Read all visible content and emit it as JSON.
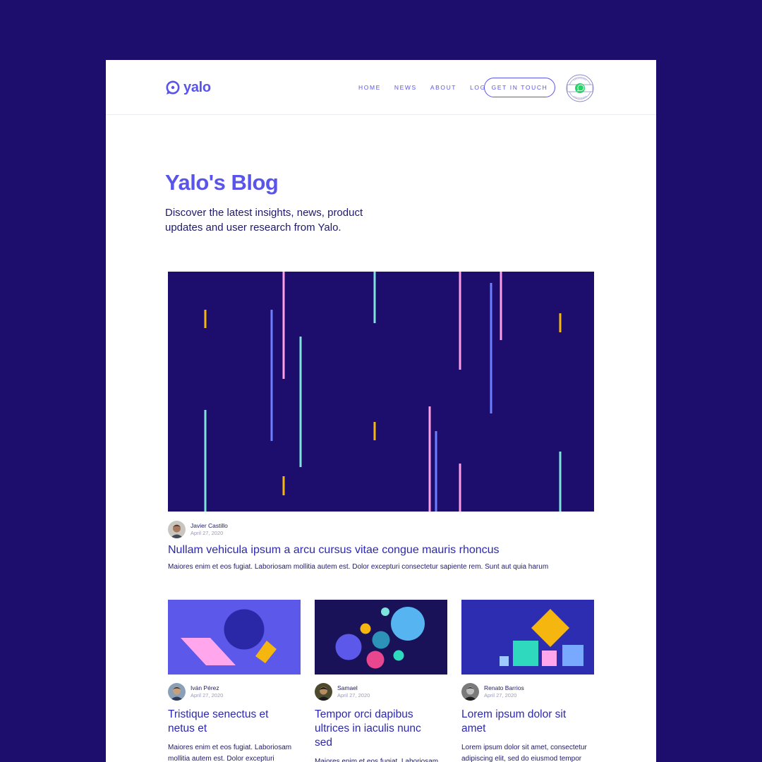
{
  "header": {
    "logo_text": "yalo",
    "nav": [
      "HOME",
      "NEWS",
      "ABOUT",
      "LOGIN"
    ],
    "cta_label": "GET IN TOUCH",
    "badge_icon": "whatsapp-solutions-badge-icon"
  },
  "hero": {
    "title": "Yalo's Blog",
    "subtitle": "Discover the latest insights, news, product updates and user research from Yalo."
  },
  "featured": {
    "author": "Javier Castillo",
    "date": "April 27, 2020",
    "title": "Nullam vehicula ipsum a arcu cursus vitae congue mauris rhoncus",
    "excerpt": "Maiores enim et eos fugiat. Laboriosam mollitia autem est. Dolor excepturi consectetur sapiente rem. Sunt aut quia harum"
  },
  "posts": [
    {
      "author": "Iván Pérez",
      "date": "April 27, 2020",
      "title": "Tristique senectus et netus et",
      "excerpt": "Maiores enim et eos fugiat. Laboriosam mollitia autem est. Dolor excepturi"
    },
    {
      "author": "Samael",
      "date": "April 27, 2020",
      "title": "Tempor orci dapibus ultrices in iaculis nunc sed",
      "excerpt": "Maiores enim et eos fugiat. Laboriosam mollitia autem est. Dolor excepturi"
    },
    {
      "author": "Renato Barrios",
      "date": "April 27, 2020",
      "title": "Lorem ipsum dolor sit amet",
      "excerpt": "Lorem ipsum dolor sit amet, consectetur adipiscing elit, sed do eiusmod tempor"
    }
  ],
  "colors": {
    "background": "#1d0e6e",
    "brand": "#5a55ea",
    "heading": "#2c28b0",
    "text": "#1d1a6b"
  }
}
